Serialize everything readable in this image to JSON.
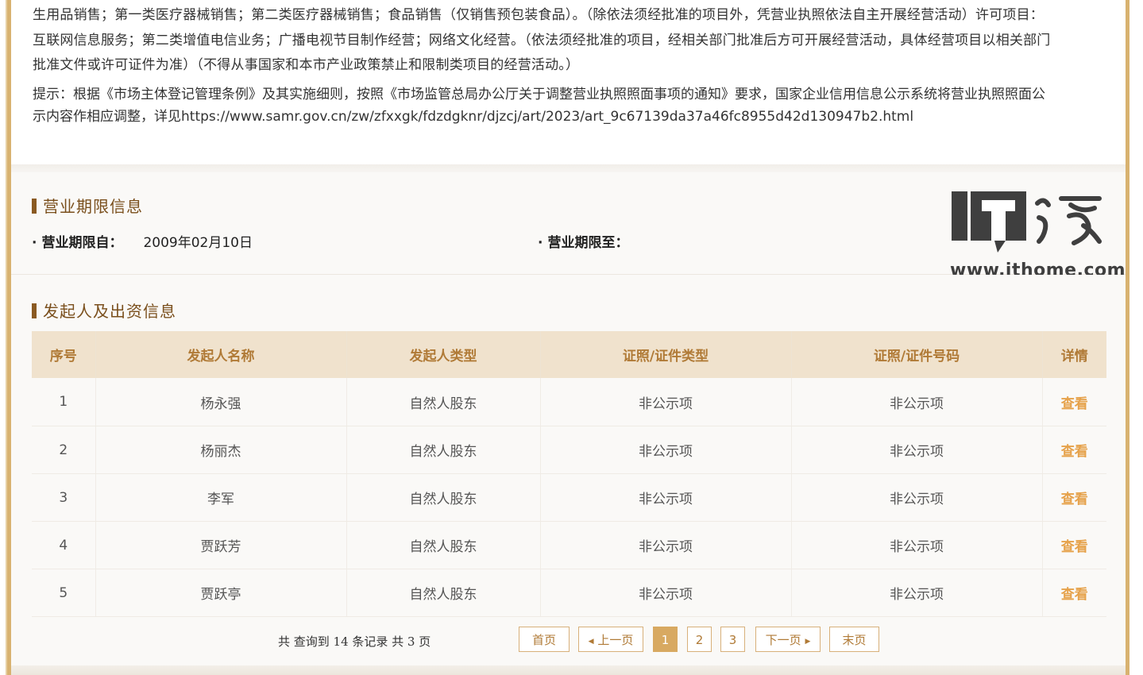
{
  "business_scope": {
    "lines": [
      "生用品销售；第一类医疗器械销售；第二类医疗器械销售；食品销售（仅销售预包装食品）。（除依法须经批准的项目外，凭营业执照依法自主开展经营活动）许可项目：",
      "互联网信息服务；第二类增值电信业务；广播电视节目制作经营；网络文化经营。（依法须经批准的项目，经相关部门批准后方可开展经营活动，具体经营项目以相关部门",
      "批准文件或许可证件为准）（不得从事国家和本市产业政策禁止和限制类项目的经营活动。）"
    ],
    "tip_lines": [
      "提示：根据《市场主体登记管理条例》及其实施细则，按照《市场监管总局办公厅关于调整营业执照照面事项的通知》要求，国家企业信用信息公示系统将营业执照照面公",
      "示内容作相应调整，详见https://www.samr.gov.cn/zw/zfxxgk/fdzdgknr/djzcj/art/2023/art_9c67139da37a46fc8955d42d130947b2.html"
    ]
  },
  "period": {
    "title": "营业期限信息",
    "from_label": "营业期限自：",
    "from_value": "2009年02月10日",
    "to_label": "营业期限至：",
    "to_value": ""
  },
  "watermark": {
    "logo_text": "IT之家",
    "url": "www.ithome.com"
  },
  "investors": {
    "title": "发起人及出资信息",
    "columns": [
      "序号",
      "发起人名称",
      "发起人类型",
      "证照/证件类型",
      "证照/证件号码",
      "详情"
    ],
    "rows": [
      {
        "no": "1",
        "name": "杨永强",
        "type": "自然人股东",
        "id_type": "非公示项",
        "id_no": "非公示项",
        "detail": "查看"
      },
      {
        "no": "2",
        "name": "杨丽杰",
        "type": "自然人股东",
        "id_type": "非公示项",
        "id_no": "非公示项",
        "detail": "查看"
      },
      {
        "no": "3",
        "name": "李军",
        "type": "自然人股东",
        "id_type": "非公示项",
        "id_no": "非公示项",
        "detail": "查看"
      },
      {
        "no": "4",
        "name": "贾跃芳",
        "type": "自然人股东",
        "id_type": "非公示项",
        "id_no": "非公示项",
        "detail": "查看"
      },
      {
        "no": "5",
        "name": "贾跃亭",
        "type": "自然人股东",
        "id_type": "非公示项",
        "id_no": "非公示项",
        "detail": "查看"
      }
    ]
  },
  "pagination": {
    "summary": "共 查询到 14 条记录 共 3 页",
    "first": "首页",
    "prev": "上一页",
    "pages": [
      "1",
      "2",
      "3"
    ],
    "current": "1",
    "next": "下一页",
    "last": "末页"
  },
  "colors": {
    "accent": "#d8b270",
    "header_bg": "#f0e2cd",
    "header_text": "#b07a36",
    "link": "#e6a24b",
    "section_title": "#7a4f1c"
  }
}
